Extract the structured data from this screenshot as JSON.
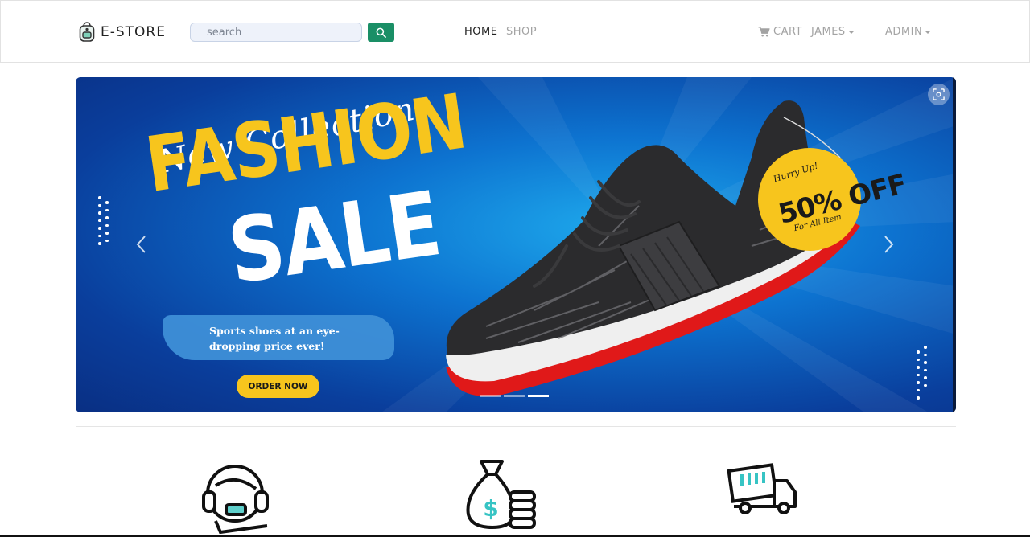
{
  "navbar": {
    "brand": "E-STORE",
    "search_placeholder": "search",
    "links": {
      "home": "HOME",
      "shop": "SHOP",
      "cart": "CART",
      "user": "JAMES",
      "admin": "ADMIN"
    },
    "accent": "#1a8f66"
  },
  "carousel": {
    "script_text": "New Collection",
    "headline_1": "FASHION",
    "headline_2": "SALE",
    "description": "Sports shoes at an eye-dropping price ever!",
    "cta": "ORDER NOW",
    "badge": {
      "top": "Hurry Up!",
      "main": "50% OFF",
      "bottom": "For All Item"
    },
    "active_slide": 3,
    "slide_count": 3,
    "colors": {
      "yellow": "#f7c51d",
      "blue": "#0d73d0",
      "shoe_sole": "#e01919"
    }
  },
  "features": [
    {
      "icon": "support-headset-icon"
    },
    {
      "icon": "money-bag-icon"
    },
    {
      "icon": "delivery-truck-icon"
    }
  ]
}
